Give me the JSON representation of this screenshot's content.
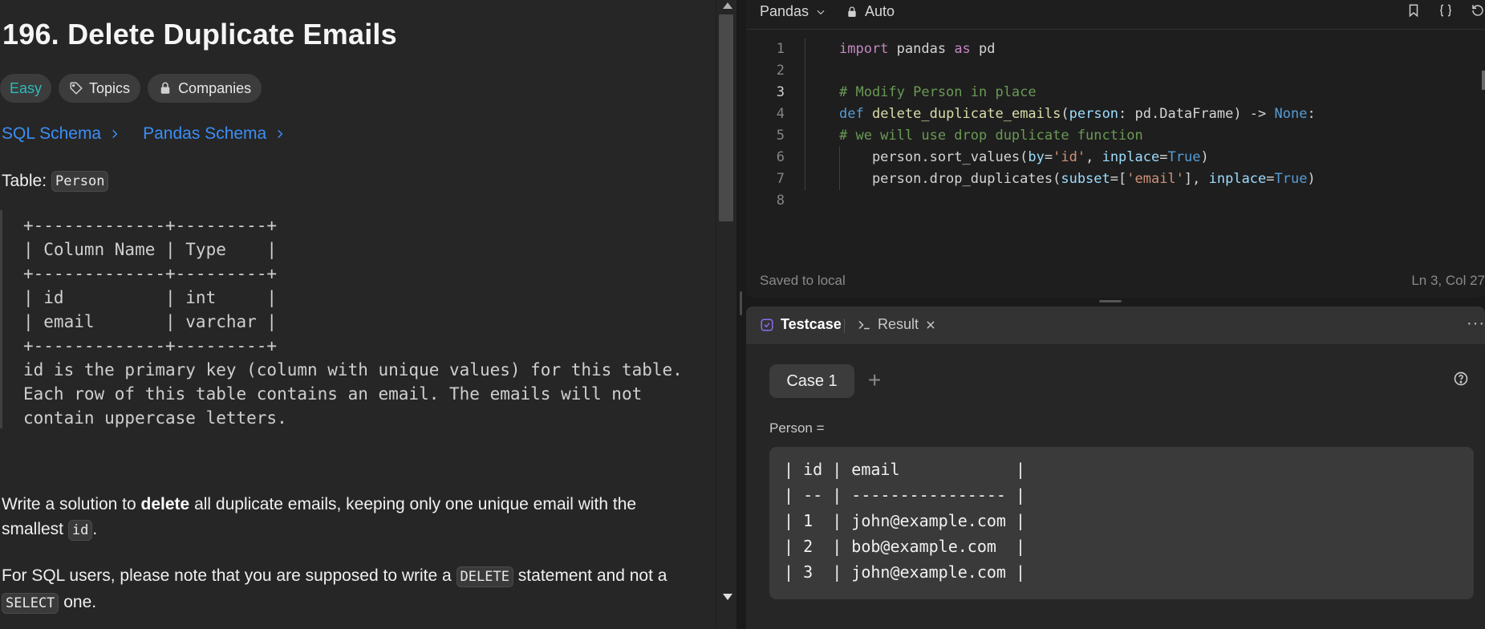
{
  "problem": {
    "title": "196. Delete Duplicate Emails",
    "tags": {
      "difficulty": "Easy",
      "topics": "Topics",
      "companies": "Companies"
    },
    "schemas": {
      "sql": "SQL Schema",
      "pandas": "Pandas Schema"
    },
    "table_label": "Table:",
    "table_name": "Person",
    "schema_block": "+-------------+---------+\n| Column Name | Type    |\n+-------------+---------+\n| id          | int     |\n| email       | varchar |\n+-------------+---------+\nid is the primary key (column with unique values) for this table.\nEach row of this table contains an email. The emails will not\ncontain uppercase letters.",
    "para1": {
      "pre": "Write a solution to ",
      "bold": "delete",
      "mid": " all duplicate emails, keeping only one unique email with the smallest ",
      "code": "id",
      "post": "."
    },
    "para2": {
      "pre": "For SQL users, please note that you are supposed to write a ",
      "code1": "DELETE",
      "mid": " statement and not a ",
      "code2": "SELECT",
      "post": " one."
    }
  },
  "editor": {
    "language": "Pandas",
    "mode": "Auto",
    "status": "Saved to local",
    "cursor": "Ln 3, Col 27",
    "icons": [
      "bookmark-icon",
      "braces-icon",
      "reset-icon"
    ],
    "line_numbers": [
      "1",
      "2",
      "3",
      "4",
      "5",
      "6",
      "7",
      "8"
    ],
    "active_line": 3,
    "code_lines": [
      [
        {
          "t": "import",
          "c": "kw"
        },
        {
          "t": " pandas ",
          "c": ""
        },
        {
          "t": "as",
          "c": "kw"
        },
        {
          "t": " pd",
          "c": ""
        }
      ],
      [],
      [
        {
          "t": "# Modify Person in place",
          "c": "cm"
        }
      ],
      [
        {
          "t": "def",
          "c": "def"
        },
        {
          "t": " ",
          "c": ""
        },
        {
          "t": "delete_duplicate_emails",
          "c": "fn"
        },
        {
          "t": "(",
          "c": ""
        },
        {
          "t": "person",
          "c": "par"
        },
        {
          "t": ": pd.DataFrame) -> ",
          "c": ""
        },
        {
          "t": "None",
          "c": "cst"
        },
        {
          "t": ":",
          "c": ""
        }
      ],
      [
        {
          "t": "# we will use drop duplicate function",
          "c": "cm"
        }
      ],
      [
        {
          "t": "    person.sort_values(",
          "c": ""
        },
        {
          "t": "by",
          "c": "par"
        },
        {
          "t": "=",
          "c": ""
        },
        {
          "t": "'id'",
          "c": "str"
        },
        {
          "t": ", ",
          "c": ""
        },
        {
          "t": "inplace",
          "c": "par"
        },
        {
          "t": "=",
          "c": ""
        },
        {
          "t": "True",
          "c": "cst"
        },
        {
          "t": ")",
          "c": ""
        }
      ],
      [
        {
          "t": "    person.drop_duplicates(",
          "c": ""
        },
        {
          "t": "subset",
          "c": "par"
        },
        {
          "t": "=[",
          "c": ""
        },
        {
          "t": "'email'",
          "c": "str"
        },
        {
          "t": "], ",
          "c": ""
        },
        {
          "t": "inplace",
          "c": "par"
        },
        {
          "t": "=",
          "c": ""
        },
        {
          "t": "True",
          "c": "cst"
        },
        {
          "t": ")",
          "c": ""
        }
      ],
      []
    ]
  },
  "testcase": {
    "tab_testcase": "Testcase",
    "tab_result": "Result",
    "case_label": "Case 1",
    "add_label": "+",
    "more_label": "···",
    "input_label": "Person =",
    "input_value": "| id | email            |\n| -- | ---------------- |\n| 1  | john@example.com |\n| 2  | bob@example.com  |\n| 3  | john@example.com |"
  },
  "colors": {
    "easy": "#2cbbba",
    "link": "#3b8ef6",
    "testcase_icon": "#8c6cf0"
  }
}
